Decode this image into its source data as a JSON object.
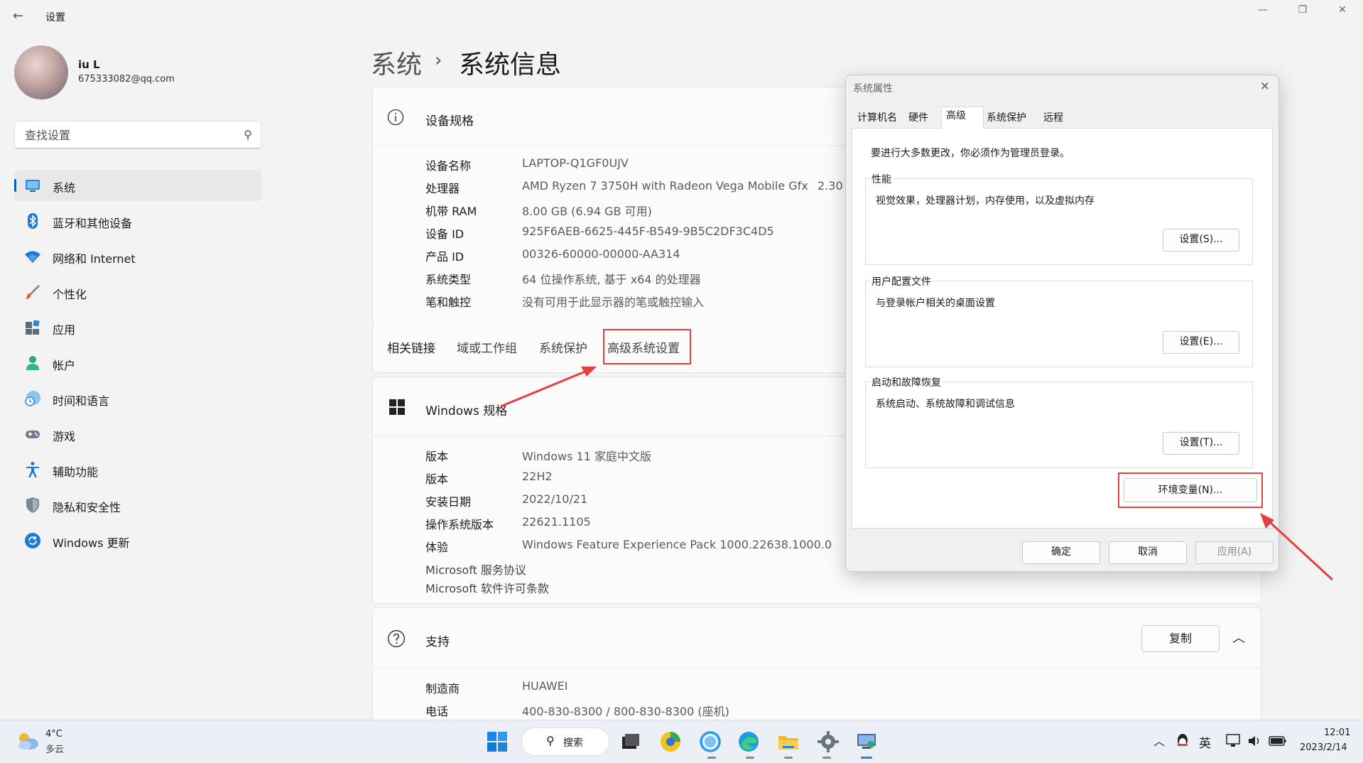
{
  "window": {
    "title": "设置",
    "back_label": "←",
    "minimize": "—",
    "restore": "❐",
    "close": "✕"
  },
  "profile": {
    "name": "iu L",
    "email": "675333082@qq.com"
  },
  "search": {
    "placeholder": "查找设置"
  },
  "nav": [
    {
      "label": "系统",
      "icon": "monitor-icon",
      "active": true
    },
    {
      "label": "蓝牙和其他设备",
      "icon": "bluetooth-icon"
    },
    {
      "label": "网络和 Internet",
      "icon": "wifi-icon"
    },
    {
      "label": "个性化",
      "icon": "brush-icon"
    },
    {
      "label": "应用",
      "icon": "apps-icon"
    },
    {
      "label": "帐户",
      "icon": "account-icon"
    },
    {
      "label": "时间和语言",
      "icon": "clock-globe-icon"
    },
    {
      "label": "游戏",
      "icon": "gamepad-icon"
    },
    {
      "label": "辅助功能",
      "icon": "accessibility-icon"
    },
    {
      "label": "隐私和安全性",
      "icon": "shield-icon"
    },
    {
      "label": "Windows 更新",
      "icon": "update-icon"
    }
  ],
  "breadcrumb": {
    "parent": "系统",
    "separator": "›",
    "current": "系统信息"
  },
  "device_spec": {
    "title": "设备规格",
    "rows": [
      {
        "label": "设备名称",
        "value": "LAPTOP-Q1GF0UJV"
      },
      {
        "label": "处理器",
        "value": "AMD Ryzen 7 3750H with Radeon Vega Mobile Gfx",
        "extra": "2.30"
      },
      {
        "label": "机带 RAM",
        "value": "8.00 GB (6.94 GB 可用)"
      },
      {
        "label": "设备 ID",
        "value": "925F6AEB-6625-445F-B549-9B5C2DF3C4D5"
      },
      {
        "label": "产品 ID",
        "value": "00326-60000-00000-AA314"
      },
      {
        "label": "系统类型",
        "value": "64 位操作系统, 基于 x64 的处理器"
      },
      {
        "label": "笔和触控",
        "value": "没有可用于此显示器的笔或触控输入"
      }
    ]
  },
  "related_links": {
    "title": "相关链接",
    "links": [
      "域或工作组",
      "系统保护",
      "高级系统设置"
    ]
  },
  "windows_spec": {
    "title": "Windows 规格",
    "rows": [
      {
        "label": "版本",
        "value": "Windows 11 家庭中文版"
      },
      {
        "label": "版本",
        "value": "22H2"
      },
      {
        "label": "安装日期",
        "value": "2022/10/21"
      },
      {
        "label": "操作系统版本",
        "value": "22621.1105"
      },
      {
        "label": "体验",
        "value": "Windows Feature Experience Pack 1000.22638.1000.0"
      }
    ],
    "links": [
      "Microsoft 服务协议",
      "Microsoft 软件许可条款"
    ]
  },
  "support": {
    "title": "支持",
    "copy_label": "复制",
    "collapse": "︿",
    "rows": [
      {
        "label": "制造商",
        "value": "HUAWEI"
      },
      {
        "label": "电话",
        "value": "400-830-8300 / 800-830-8300 (座机)"
      }
    ]
  },
  "dialog": {
    "title": "系统属性",
    "close": "✕",
    "tabs": [
      "计算机名",
      "硬件",
      "高级",
      "系统保护",
      "远程"
    ],
    "selected_tab": "高级",
    "admin_note": "要进行大多数更改，你必须作为管理员登录。",
    "groups": [
      {
        "title": "性能",
        "desc": "视觉效果，处理器计划，内存使用，以及虚拟内存",
        "button": "设置(S)..."
      },
      {
        "title": "用户配置文件",
        "desc": "与登录帐户相关的桌面设置",
        "button": "设置(E)..."
      },
      {
        "title": "启动和故障恢复",
        "desc": "系统启动、系统故障和调试信息",
        "button": "设置(T)..."
      }
    ],
    "env_button": "环境变量(N)...",
    "ok": "确定",
    "cancel": "取消",
    "apply": "应用(A)"
  },
  "taskbar": {
    "weather_temp": "4°C",
    "weather_desc": "多云",
    "search_label": "搜索",
    "tray_chevron": "︿",
    "ime": "英",
    "time": "12:01",
    "date": "2023/2/14"
  },
  "colors": {
    "accent": "#005fb8",
    "highlight": "#e34040"
  }
}
